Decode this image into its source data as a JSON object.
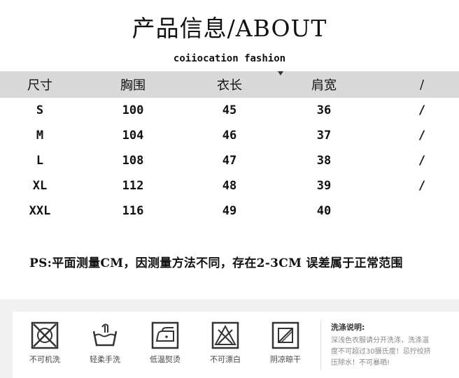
{
  "header": {
    "title": "产品信息/ABOUT",
    "subtitle": "coiiocation fashion"
  },
  "table": {
    "columns": [
      "尺寸",
      "胸围",
      "衣长",
      "肩宽",
      "/"
    ],
    "rows": [
      [
        "S",
        "100",
        "45",
        "36",
        "/"
      ],
      [
        "M",
        "104",
        "46",
        "37",
        "/"
      ],
      [
        "L",
        "108",
        "47",
        "38",
        "/"
      ],
      [
        "XL",
        "112",
        "48",
        "39",
        "/"
      ],
      [
        "XXL",
        "116",
        "49",
        "40",
        ""
      ]
    ]
  },
  "note": "PS:平面测量CM，因测量方法不同，存在2-3CM 误差属于正常范围",
  "care": {
    "icons": [
      {
        "icon": "no-machine-wash-icon",
        "label": "不可机洗"
      },
      {
        "icon": "gentle-hand-wash-icon",
        "label": "轻柔手洗"
      },
      {
        "icon": "low-temp-iron-icon",
        "label": "低温熨烫"
      },
      {
        "icon": "no-bleach-icon",
        "label": "不可漂白"
      },
      {
        "icon": "shade-dry-icon",
        "label": "阴凉晾干"
      }
    ],
    "note_title": "洗涤说明:",
    "note_lines": [
      "深浅色衣服请分开洗涤，洗涤温",
      "度不可超过30摄氏度！忌拧绞挤",
      "压除水！不可暴晒!"
    ]
  }
}
